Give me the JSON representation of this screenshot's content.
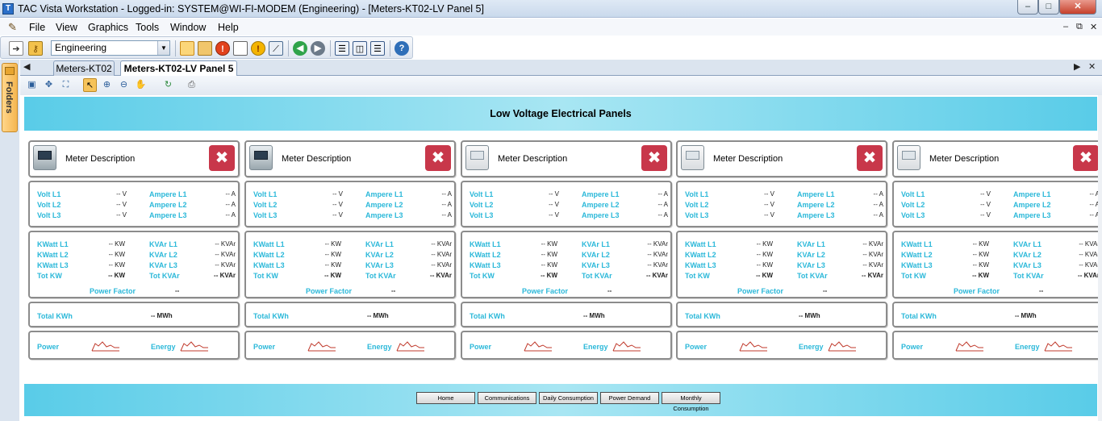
{
  "window": {
    "title": "TAC Vista Workstation - Logged-in: SYSTEM@WI-FI-MODEM (Engineering) - [Meters-KT02-LV Panel 5]",
    "controls": {
      "minimize": "–",
      "maximize": "□",
      "close": "✕"
    }
  },
  "menu": {
    "items": [
      "File",
      "View",
      "Graphics",
      "Tools",
      "Window",
      "Help"
    ],
    "mdi": {
      "minimize": "–",
      "restore": "⧉",
      "close": "✕"
    }
  },
  "toolbar": {
    "workspace": "Engineering"
  },
  "sidebar": {
    "folders_label": "Folders"
  },
  "tabs": [
    {
      "label": "Meters-KT02",
      "active": false
    },
    {
      "label": "Meters-KT02-LV Panel 5",
      "active": true
    }
  ],
  "page": {
    "title": "Low Voltage Electrical Panels"
  },
  "labels": {
    "meter_description": "Meter Description",
    "volt_l1": "Volt L1",
    "volt_l2": "Volt L2",
    "volt_l3": "Volt L3",
    "amp_l1": "Ampere L1",
    "amp_l2": "Ampere L2",
    "amp_l3": "Ampere L3",
    "kw_l1": "KWatt L1",
    "kw_l2": "KWatt L2",
    "kw_l3": "KWatt L3",
    "kvar_l1": "KVAr L1",
    "kvar_l2": "KVAr L2",
    "kvar_l3": "KVAr L3",
    "tot_kw": "Tot KW",
    "tot_kvar": "Tot KVAr",
    "power_factor": "Power Factor",
    "total_kwh": "Total KWh",
    "power": "Power",
    "energy": "Energy"
  },
  "values": {
    "volt": "-- V",
    "amp": "-- A",
    "kw": "-- KW",
    "kvar": "-- KVAr",
    "pf": "--",
    "kwh": "-- MWh"
  },
  "panels": [
    {
      "icon": "dark"
    },
    {
      "icon": "dark"
    },
    {
      "icon": "light"
    },
    {
      "icon": "light"
    },
    {
      "icon": "light"
    }
  ],
  "nav": [
    "Home",
    "Communications",
    "Daily Consumption",
    "Power Demand",
    "Monthly Consumption"
  ]
}
